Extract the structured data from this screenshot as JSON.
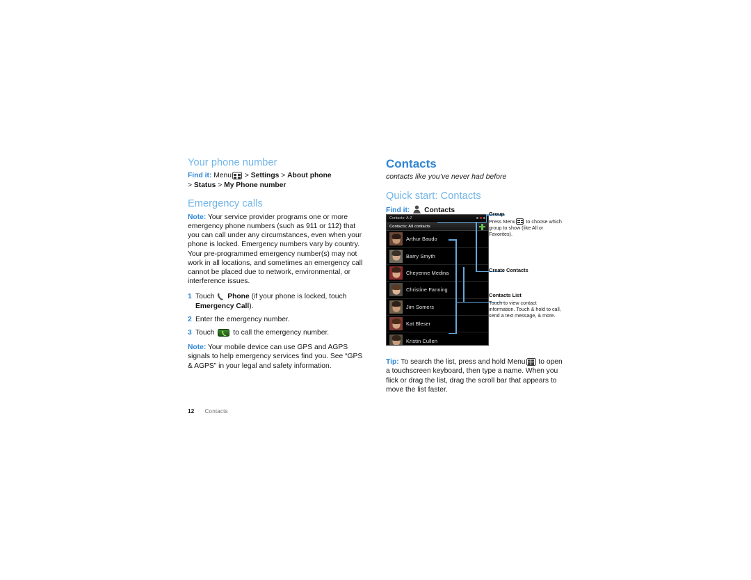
{
  "page": {
    "number": "12",
    "running_title": "Contacts"
  },
  "left_column": {
    "section1": {
      "heading": "Your phone number",
      "findit_label": "Find it:",
      "findit_pre": "Menu",
      "findit_icon": "menu-grid-icon",
      "findit_path_line1": "Settings",
      "findit_path_line1b": "About phone",
      "findit_path_line2a": "Status",
      "findit_path_line2b": "My Phone number",
      "separator": ">"
    },
    "section2": {
      "heading": "Emergency calls",
      "note_label": "Note:",
      "note_body": "Your service provider programs one or more emergency phone numbers (such as 911 or 112) that you can call under any circumstances, even when your phone is locked. Emergency numbers vary by country. Your pre-programmed emergency number(s) may not work in all locations, and sometimes an emergency call cannot be placed due to network, environmental, or interference issues.",
      "steps": [
        {
          "num": "1",
          "pre": "Touch",
          "icon": "phone-handset-icon",
          "bold1": "Phone",
          "mid": "(if your phone is locked, touch",
          "bold2": "Emergency Call",
          "post": ")."
        },
        {
          "num": "2",
          "text": "Enter the emergency number."
        },
        {
          "num": "3",
          "pre": "Touch",
          "icon": "green-call-button-icon",
          "post": "to call the emergency number."
        }
      ],
      "note2_label": "Note:",
      "note2_body": "Your mobile device can use GPS and AGPS signals to help emergency services find you. See “GPS & AGPS” in your legal and safety information."
    }
  },
  "right_column": {
    "chapter_title": "Contacts",
    "chapter_subtitle": "contacts like you’ve never had before",
    "quickstart_heading": "Quick start: Contacts",
    "findit_label": "Find it:",
    "findit_icon": "contacts-person-icon",
    "findit_target": "Contacts",
    "phone_screen": {
      "status_bar_text": "Contacts: A-Z",
      "status_icons": [
        "signal-dot-icon",
        "alert-dot-icon",
        "battery-dot-icon"
      ],
      "title_bar_text": "Contacts: All contacts",
      "add_button_icon": "plus-icon",
      "contacts": [
        {
          "name": "Arthur Baudo",
          "avatar_bg": "#6b4a3a",
          "hair": "#2b1b14",
          "skin": "#c89a78"
        },
        {
          "name": "Barry Smyth",
          "avatar_bg": "#6f6a5e",
          "hair": "#3a3027",
          "skin": "#cfa88a"
        },
        {
          "name": "Cheyenne Medina",
          "avatar_bg": "#8a2f2f",
          "hair": "#3d2318",
          "skin": "#d8a887"
        },
        {
          "name": "Christine Fanning",
          "avatar_bg": "#4d4a45",
          "hair": "#5a3a22",
          "skin": "#dcb294"
        },
        {
          "name": "Jim Somers",
          "avatar_bg": "#6d5f4c",
          "hair": "#2e2018",
          "skin": "#c79a79"
        },
        {
          "name": "Kat Bleser",
          "avatar_bg": "#7d3b33",
          "hair": "#4a2a18",
          "skin": "#d3a484"
        },
        {
          "name": "Kristin Cullen",
          "avatar_bg": "#595044",
          "hair": "#33241a",
          "skin": "#cb9d7d"
        }
      ]
    },
    "callouts": [
      {
        "title": "Group",
        "body_pre": "Press Menu",
        "body_icon": "menu-grid-icon",
        "body_post": "to choose which group to show (like All or Favorites)."
      },
      {
        "title": "Create Contacts",
        "body": ""
      },
      {
        "title": "Contacts  List",
        "body": "Touch to view contact information. Touch & hold to call, send a text message, & more."
      }
    ],
    "tip": {
      "label": "Tip:",
      "body_pre": "To search the list, press and hold Menu",
      "body_icon": "menu-grid-icon",
      "body_post": "to open a touchscreen keyboard, then type a name. When you flick or drag the list, drag the scroll bar that appears to move the list faster."
    }
  },
  "colors": {
    "heading_light_blue": "#6fb4e8",
    "heading_blue": "#2f86d4",
    "callout_line": "#64a8dd",
    "accent_green": "#5ec34a"
  }
}
